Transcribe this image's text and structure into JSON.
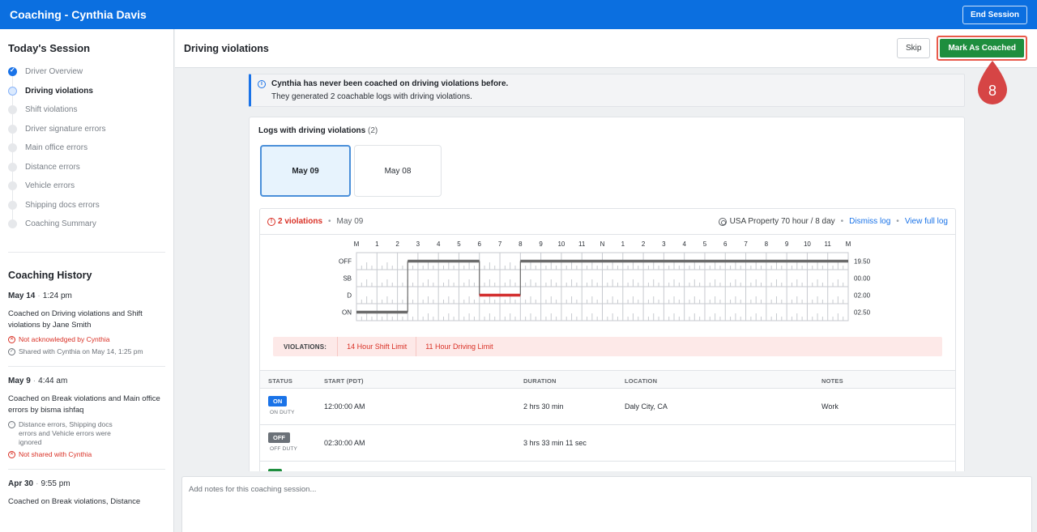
{
  "topbar": {
    "title": "Coaching - Cynthia Davis",
    "end_session": "End Session"
  },
  "sidebar": {
    "session_title": "Today's Session",
    "steps": [
      {
        "label": "Driver Overview",
        "state": "done"
      },
      {
        "label": "Driving violations",
        "state": "active"
      },
      {
        "label": "Shift violations",
        "state": "pending"
      },
      {
        "label": "Driver signature errors",
        "state": "pending"
      },
      {
        "label": "Main office errors",
        "state": "pending"
      },
      {
        "label": "Distance errors",
        "state": "pending"
      },
      {
        "label": "Vehicle errors",
        "state": "pending"
      },
      {
        "label": "Shipping docs errors",
        "state": "pending"
      },
      {
        "label": "Coaching Summary",
        "state": "pending"
      }
    ],
    "history_title": "Coaching History",
    "history": [
      {
        "date": "May 14",
        "time": "1:24 pm",
        "desc": "Coached on Driving violations and Shift violations by Jane Smith",
        "meta": [
          {
            "text": "Not acknowledged by Cynthia",
            "tone": "red",
            "icon": "x-circle-icon"
          },
          {
            "text": "Shared with Cynthia on May 14, 1:25 pm",
            "tone": "gray",
            "icon": "check-circle-icon"
          }
        ]
      },
      {
        "date": "May 9",
        "time": "4:44 am",
        "desc": "Coached on Break violations and Main office errors by bisma ishfaq",
        "meta": [
          {
            "text": "Distance errors, Shipping docs errors and Vehicle errors were ignored",
            "tone": "gray",
            "icon": "shield-icon"
          },
          {
            "text": "Not shared with Cynthia",
            "tone": "red",
            "icon": "x-circle-icon"
          }
        ]
      },
      {
        "date": "Apr 30",
        "time": "9:55 pm",
        "desc": "Coached on Break violations, Distance",
        "meta": []
      }
    ]
  },
  "header": {
    "title": "Driving violations",
    "skip": "Skip",
    "mark_coached": "Mark As Coached"
  },
  "marker": {
    "number": "8",
    "color": "#d64545"
  },
  "info": {
    "line1": "Cynthia has never been coached on driving violations before.",
    "line2": "They generated 2 coachable logs with driving violations."
  },
  "logs": {
    "title": "Logs with driving violations",
    "count": "(2)",
    "days": [
      {
        "label": "May 09",
        "selected": true
      },
      {
        "label": "May 08",
        "selected": false
      }
    ]
  },
  "log_panel": {
    "violations_label": "2 violations",
    "date": "May 09",
    "ruleset": "USA Property 70 hour / 8 day",
    "dismiss": "Dismiss log",
    "view_full": "View full log",
    "graph": {
      "hour_labels": [
        "M",
        "1",
        "2",
        "3",
        "4",
        "5",
        "6",
        "7",
        "8",
        "9",
        "10",
        "11",
        "N",
        "1",
        "2",
        "3",
        "4",
        "5",
        "6",
        "7",
        "8",
        "9",
        "10",
        "11",
        "M"
      ],
      "rows": [
        {
          "label": "OFF",
          "total": "19.50"
        },
        {
          "label": "SB",
          "total": "00.00"
        },
        {
          "label": "D",
          "total": "02.00"
        },
        {
          "label": "ON",
          "total": "02.50"
        }
      ],
      "segments": [
        {
          "row": "ON",
          "start": 0,
          "end": 2.5
        },
        {
          "row": "OFF",
          "start": 2.5,
          "end": 6
        },
        {
          "row": "D",
          "start": 6,
          "end": 8,
          "violation": true
        },
        {
          "row": "OFF",
          "start": 8,
          "end": 24
        }
      ],
      "colors": {
        "normal": "#6b6b6b",
        "violation": "#d32f2f"
      }
    },
    "violations_title": "VIOLATIONS:",
    "violations": [
      "14 Hour Shift Limit",
      "11 Hour Driving Limit"
    ]
  },
  "table": {
    "headers": [
      "STATUS",
      "START (PDT)",
      "DURATION",
      "LOCATION",
      "NOTES"
    ],
    "rows": [
      {
        "badge": "ON",
        "kind": "on",
        "sub": "ON DUTY",
        "start": "12:00:00 AM",
        "duration": "2 hrs 30 min",
        "location": "Daly City, CA",
        "notes": "Work"
      },
      {
        "badge": "OFF",
        "kind": "off",
        "sub": "OFF DUTY",
        "start": "02:30:00 AM",
        "duration": "3 hrs 33 min 11 sec",
        "location": "",
        "notes": ""
      },
      {
        "badge": "D",
        "kind": "d",
        "sub": "",
        "start": "",
        "duration": "",
        "location": "",
        "notes": ""
      }
    ]
  },
  "notes": {
    "placeholder": "Add notes for this coaching session..."
  }
}
